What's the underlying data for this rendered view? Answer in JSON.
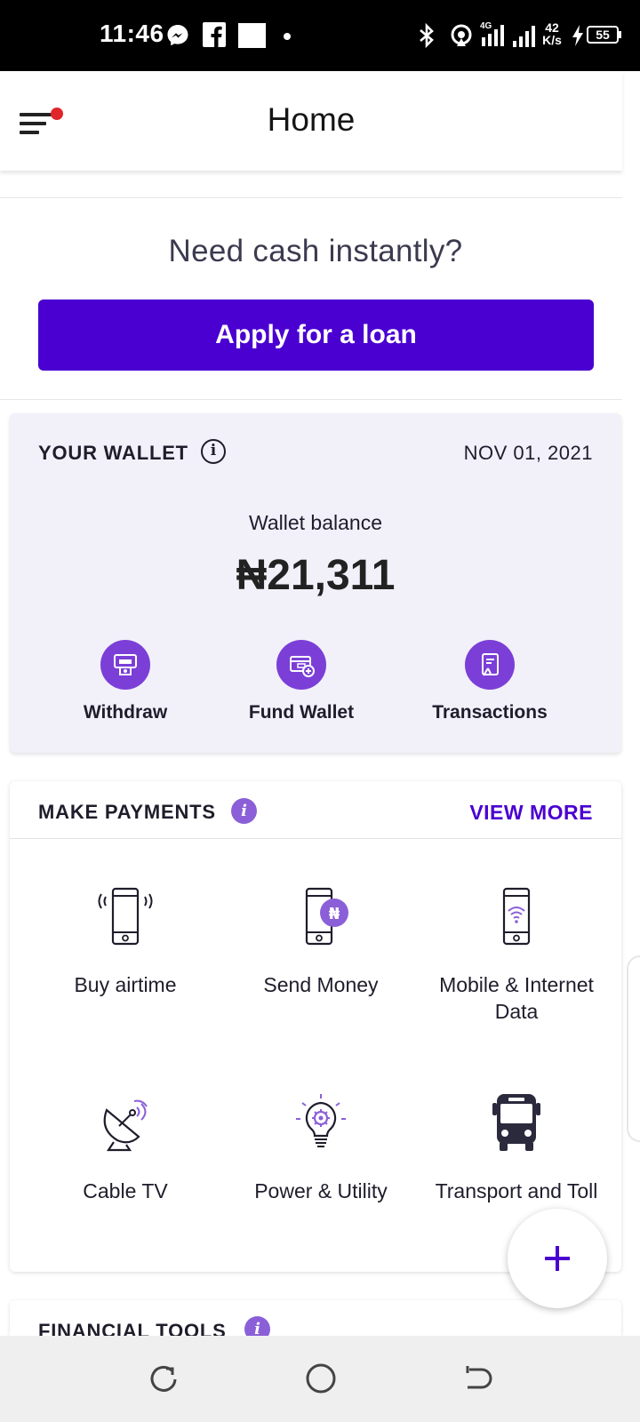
{
  "status_bar": {
    "time": "11:46",
    "network": "4G",
    "speed_value": "42",
    "speed_unit": "K/s",
    "battery": "55"
  },
  "app_bar": {
    "title": "Home",
    "menu_icon": "menu-icon",
    "notification_dot_color": "#e0252b"
  },
  "promo": {
    "headline": "Need cash instantly?",
    "button_label": "Apply for a loan"
  },
  "wallet": {
    "header": "YOUR WALLET",
    "date": "NOV 01, 2021",
    "balance_label": "Wallet balance",
    "balance": "₦21,311",
    "actions": [
      {
        "label": "Withdraw",
        "icon": "atm-withdraw-icon"
      },
      {
        "label": "Fund Wallet",
        "icon": "fund-wallet-icon"
      },
      {
        "label": "Transactions",
        "icon": "transactions-icon"
      }
    ]
  },
  "payments": {
    "header": "MAKE PAYMENTS",
    "view_more": "VIEW MORE",
    "items": [
      {
        "label": "Buy airtime",
        "icon": "phone-signal-icon"
      },
      {
        "label": "Send Money",
        "icon": "phone-naira-icon"
      },
      {
        "label": "Mobile & Internet Data",
        "icon": "phone-wifi-icon"
      },
      {
        "label": "Cable TV",
        "icon": "satellite-dish-icon"
      },
      {
        "label": "Power & Utility",
        "icon": "lightbulb-icon"
      },
      {
        "label": "Transport and Toll",
        "icon": "bus-icon"
      }
    ],
    "naira_symbol": "₦"
  },
  "financial_tools": {
    "header": "FINANCIAL TOOLS"
  },
  "colors": {
    "primary": "#4a00d1",
    "accent_purple": "#7b3fd7",
    "wallet_bg": "#f2f0f9"
  }
}
